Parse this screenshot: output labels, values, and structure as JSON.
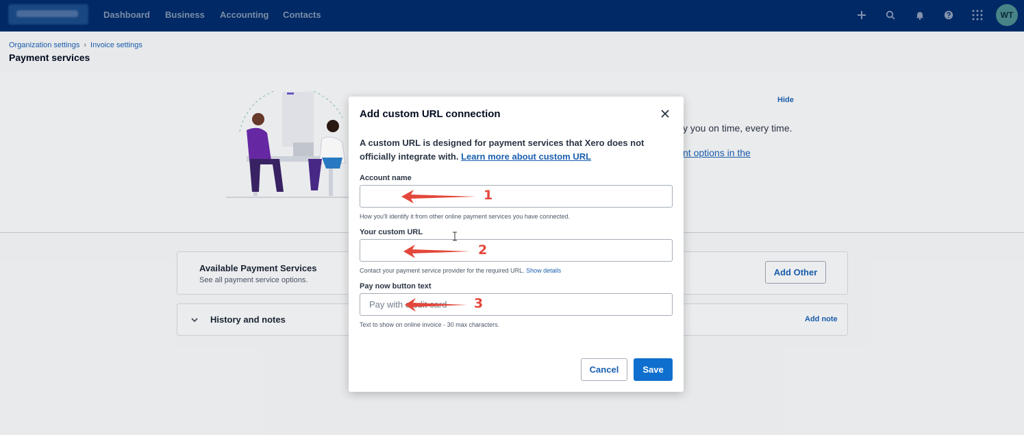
{
  "nav": {
    "links": [
      "Dashboard",
      "Business",
      "Accounting",
      "Contacts"
    ],
    "icons": [
      "plus-icon",
      "search-icon",
      "bell-icon",
      "help-icon",
      "apps-grid-icon"
    ],
    "avatar_initials": "WT",
    "bar_color": "#002b69"
  },
  "breadcrumb": {
    "items": [
      "Organization settings",
      "Invoice settings"
    ]
  },
  "page": {
    "title": "Payment services",
    "hide_label": "Hide",
    "hero_text": "y you on time, every time.",
    "hero_link": "nt options in the"
  },
  "cards": {
    "available": {
      "title": "Available Payment Services",
      "subtitle": "See all payment service options.",
      "button": "Add Other"
    },
    "history": {
      "title": "History and notes",
      "action": "Add note"
    }
  },
  "modal": {
    "title": "Add custom URL connection",
    "description": "A custom URL is designed for payment services that Xero does not officially integrate with.",
    "description_link": "Learn more about custom URL",
    "fields": {
      "account_name": {
        "label": "Account name",
        "value": "",
        "help": "How you'll identify it from other online payment services you have connected."
      },
      "custom_url": {
        "label": "Your custom URL",
        "value": "",
        "help": "Contact your payment service provider for the required URL.",
        "help_link": "Show details"
      },
      "pay_now_text": {
        "label": "Pay now button text",
        "placeholder": "Pay with credit card",
        "help": "Text to show on online invoice - 30 max characters."
      }
    },
    "cancel_label": "Cancel",
    "save_label": "Save"
  },
  "annotations": {
    "numbers": [
      "1",
      "2",
      "3"
    ],
    "color": "#e3473b"
  }
}
